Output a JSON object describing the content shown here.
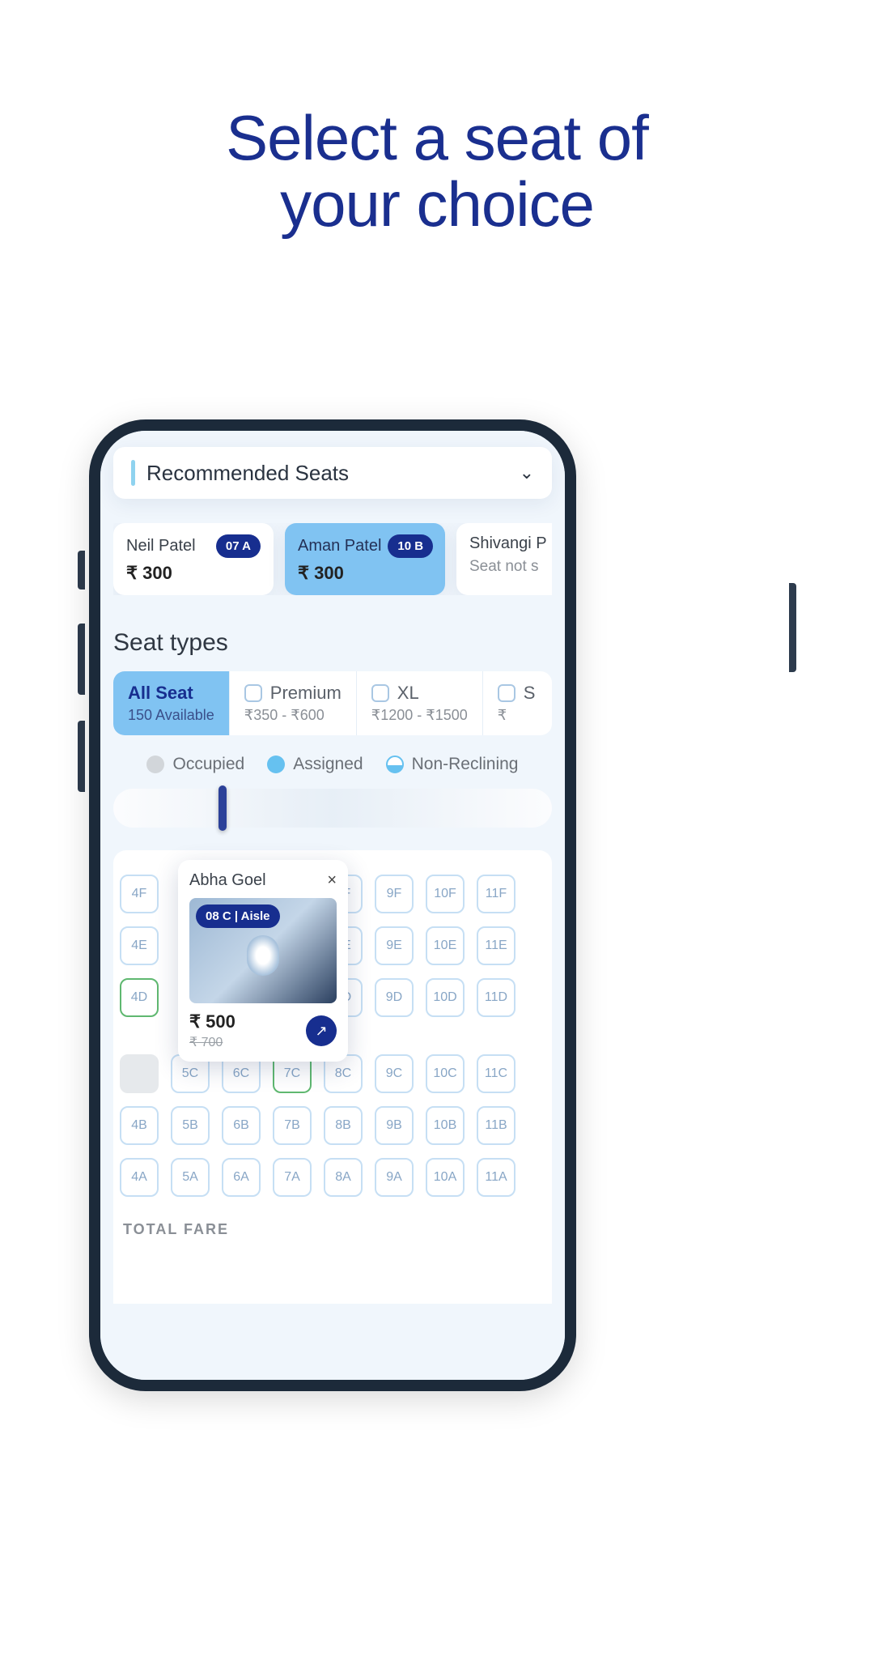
{
  "headline_line1": "Select a seat of",
  "headline_line2": "your choice",
  "recommended": {
    "title": "Recommended Seats"
  },
  "passengers": [
    {
      "name": "Neil Patel",
      "seat": "07 A",
      "price": "₹ 300",
      "selected": false
    },
    {
      "name": "Aman Patel",
      "seat": "10 B",
      "price": "₹ 300",
      "selected": true
    },
    {
      "name": "Shivangi P",
      "note": "Seat not s",
      "selected": false
    }
  ],
  "seat_types_heading": "Seat types",
  "types": [
    {
      "name": "All Seat",
      "sub": "150 Available",
      "active": true
    },
    {
      "name": "Premium",
      "sub": "₹350 - ₹600",
      "active": false
    },
    {
      "name": "XL",
      "sub": "₹1200 - ₹1500",
      "active": false
    },
    {
      "name": "S",
      "sub": "₹",
      "active": false
    }
  ],
  "legend": {
    "occupied": "Occupied",
    "assigned": "Assigned",
    "non_reclining": "Non-Reclining"
  },
  "popup": {
    "name": "Abha Goel",
    "seat_label": "08 C | Aisle",
    "price": "₹ 500",
    "old_price": "₹ 700"
  },
  "seat_rows": {
    "F": [
      "4F",
      "",
      "",
      "",
      "8F",
      "9F",
      "10F",
      "11F"
    ],
    "E": [
      "4E",
      "",
      "",
      "",
      "8E",
      "9E",
      "10E",
      "11E"
    ],
    "D": [
      "4D",
      "",
      "",
      "",
      "8D",
      "9D",
      "10D",
      "11D"
    ],
    "C": [
      "",
      "5C",
      "6C",
      "7C",
      "8C",
      "9C",
      "10C",
      "11C"
    ],
    "B": [
      "4B",
      "5B",
      "6B",
      "7B",
      "8B",
      "9B",
      "10B",
      "11B"
    ],
    "A": [
      "4A",
      "5A",
      "6A",
      "7A",
      "8A",
      "9A",
      "10A",
      "11A"
    ]
  },
  "total_label": "TOTAL FARE"
}
